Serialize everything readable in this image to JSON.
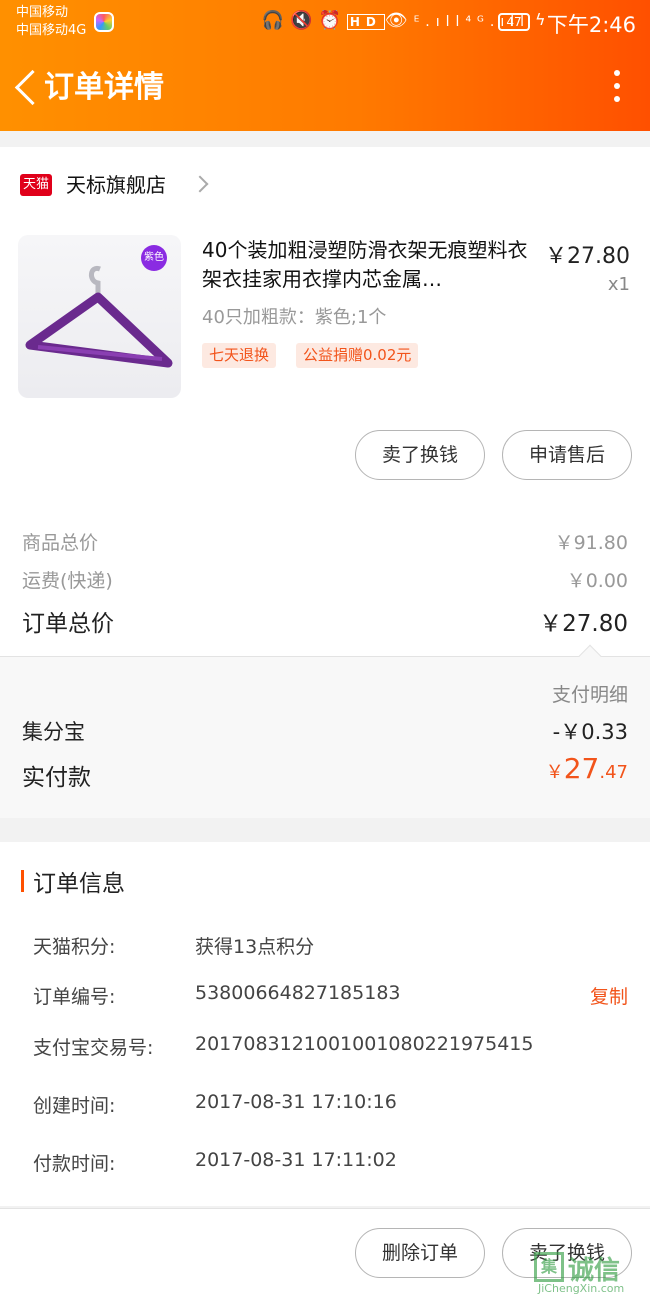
{
  "status_bar": {
    "carrier_1": "中国移动",
    "carrier_2": "中国移动4G",
    "icons": "headphones-icon mute-icon alarm-icon hd-icon eye-icon signal-icon",
    "signal_1": "ᴱ.ıll",
    "signal_2": "⁴ᴳ.ıll",
    "battery": "47",
    "time": "下午2:46"
  },
  "header": {
    "title": "订单详情"
  },
  "shop": {
    "badge": "天猫",
    "name": "天标旗舰店"
  },
  "product": {
    "title": "40个装加粗浸塑防滑衣架无痕塑料衣架衣挂家用衣撑内芯金属…",
    "price": "￥27.80",
    "quantity": "x1",
    "sku": "40只加粗款：紫色;1个",
    "image_badge": "紫色",
    "tags": [
      "七天退换",
      "公益捐赠0.02元"
    ]
  },
  "product_actions": {
    "sell": "卖了换钱",
    "after_sale": "申请售后"
  },
  "summary": {
    "goods_total_label": "商品总价",
    "goods_total": "￥91.80",
    "shipping_label": "运费(快递)",
    "shipping": "￥0.00",
    "order_total_label": "订单总价",
    "order_total": "￥27.80"
  },
  "payment": {
    "detail_link": "支付明细",
    "points_label": "集分宝",
    "points_value": "-￥0.33",
    "paid_label": "实付款",
    "paid_currency": "￥",
    "paid_int": "27",
    "paid_dec": ".47"
  },
  "order_info": {
    "title": "订单信息",
    "rows": [
      {
        "label": "天猫积分:",
        "value": "获得13点积分"
      },
      {
        "label": "订单编号:",
        "value": "53800664827185183"
      },
      {
        "label": "支付宝交易号:",
        "value": "2017083121001001080221975415"
      },
      {
        "label": "创建时间:",
        "value": "2017-08-31 17:10:16"
      },
      {
        "label": "付款时间:",
        "value": "2017-08-31 17:11:02"
      }
    ],
    "copy": "复制"
  },
  "bottom_actions": {
    "delete": "删除订单",
    "sell": "卖了换钱"
  },
  "watermark": {
    "box": "集",
    "text": "诚信",
    "url": "JiChengXin.com"
  },
  "colors": {
    "accent": "#ff5000",
    "header_start": "#ff9000",
    "price_red": "#f2541b",
    "tmall_red": "#e0001a"
  }
}
